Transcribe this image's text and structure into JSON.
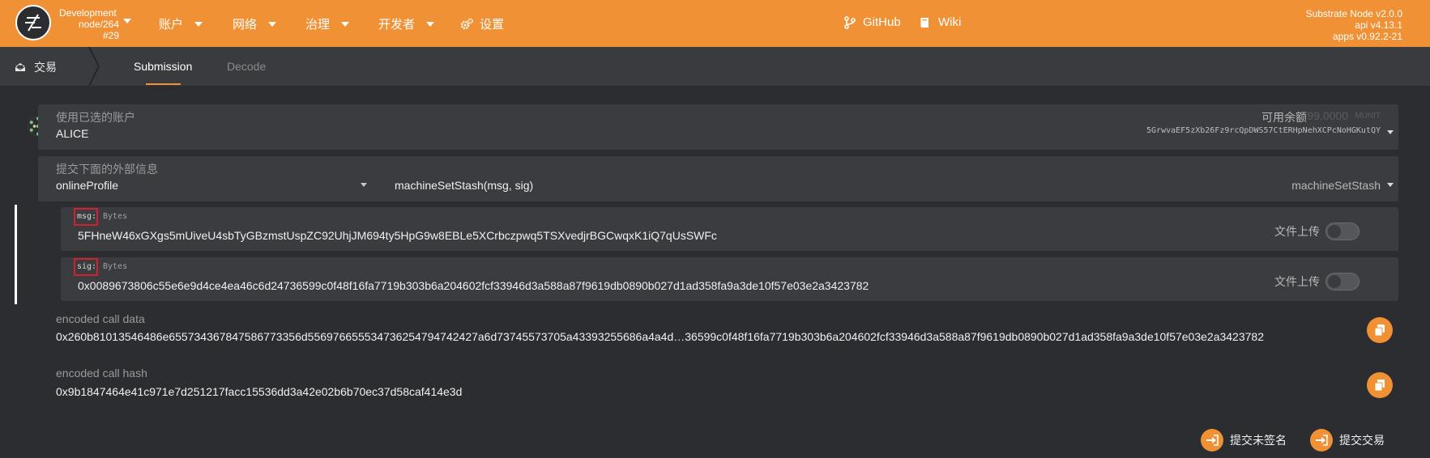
{
  "header": {
    "chain_name": "Development",
    "node_label": "node/264",
    "block_label": "#29",
    "nav": [
      {
        "label": "账户"
      },
      {
        "label": "网络"
      },
      {
        "label": "治理"
      },
      {
        "label": "开发者"
      },
      {
        "label": "设置"
      }
    ],
    "links": {
      "github": "GitHub",
      "wiki": "Wiki"
    },
    "version": {
      "node": "Substrate Node v2.0.0",
      "api": "api v4.13.1",
      "apps": "apps v0.92.2-21"
    }
  },
  "subnav": {
    "section": "交易",
    "tabs": [
      {
        "label": "Submission",
        "active": true
      },
      {
        "label": "Decode",
        "active": false
      }
    ]
  },
  "account": {
    "label": "使用已选的账户",
    "name": "ALICE",
    "balance_label": "可用余额",
    "balance_value": "99.0000",
    "balance_unit": "MUNIT",
    "address": "5GrwvaEF5zXb26Fz9rcQpDWS57CtERHpNehXCPcNoHGKutQY"
  },
  "extrinsic": {
    "label": "提交下面的外部信息",
    "module": "onlineProfile",
    "call": "machineSetStash(msg, sig)",
    "call_short": "machineSetStash"
  },
  "params": [
    {
      "name": "msg:",
      "type": "Bytes",
      "value": "5FHneW46xGXgs5mUiveU4sbTyGBzmstUspZC92UhjJM694ty5HpG9w8EBLe5XCrbczpwq5TSXvedjrBGCwqxK1iQ7qUsSWFc",
      "upload_label": "文件上传"
    },
    {
      "name": "sig:",
      "type": "Bytes",
      "value": "0x0089673806c55e6e9d4ce4ea46c6d24736599c0f48f16fa7719b303b6a204602fcf33946d3a588a87f9619db0890b027d1ad358fa9a3de10f57e03e2a3423782",
      "upload_label": "文件上传"
    }
  ],
  "encoded": {
    "data_label": "encoded call data",
    "data_value": "0x260b81013546486e655734367847586773356d556976655534736254794742427a6d73745573705a43393255686a4a4d…36599c0f48f16fa7719b303b6a204602fcf33946d3a588a87f9619db0890b027d1ad358fa9a3de10f57e03e2a3423782",
    "hash_label": "encoded call hash",
    "hash_value": "0x9b1847464e41c971e7d251217facc15536dd3a42e02b6b70ec37d58caf414e3d"
  },
  "actions": {
    "unsigned": "提交未签名",
    "submit": "提交交易"
  },
  "colors": {
    "accent": "#f19135",
    "background": "#2c2d30",
    "panel": "#3b3c40",
    "highlight_box": "#d3202e"
  }
}
